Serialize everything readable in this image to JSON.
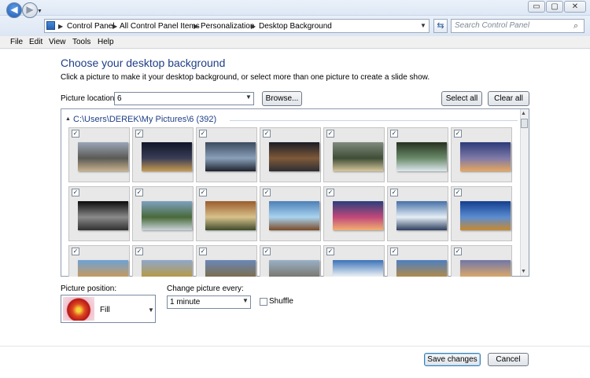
{
  "window": {
    "minimize": "▭",
    "maximize": "▢",
    "close": "✕"
  },
  "nav": {
    "breadcrumbs": [
      "Control Panel",
      "All Control Panel Items",
      "Personalization",
      "Desktop Background"
    ],
    "search_placeholder": "Search Control Panel"
  },
  "menu": [
    "File",
    "Edit",
    "View",
    "Tools",
    "Help"
  ],
  "main": {
    "heading": "Choose your desktop background",
    "subtitle": "Click a picture to make it your desktop background, or select more than one picture to create a slide show.",
    "location_label": "Picture location:",
    "location_value": "6",
    "browse_label": "Browse...",
    "select_all_label": "Select all",
    "clear_all_label": "Clear all",
    "group_header": "C:\\Users\\DEREK\\My Pictures\\6 (392)",
    "thumbnails": [
      {
        "checked": true,
        "colors": [
          "#9aa6b6",
          "#5b5a55",
          "#c8b28e"
        ]
      },
      {
        "checked": true,
        "colors": [
          "#101528",
          "#3a3d56",
          "#c89b50"
        ]
      },
      {
        "checked": true,
        "colors": [
          "#3c4a5e",
          "#8aa0b9",
          "#1d232d"
        ]
      },
      {
        "checked": true,
        "colors": [
          "#1b1d26",
          "#7e5a3a",
          "#2e2d33"
        ]
      },
      {
        "checked": true,
        "colors": [
          "#7f8b7c",
          "#3f4d37",
          "#d7c89b"
        ]
      },
      {
        "checked": true,
        "colors": [
          "#27321f",
          "#6a8a6a",
          "#dfe8ef"
        ]
      },
      {
        "checked": true,
        "colors": [
          "#2b3a78",
          "#7f7aa8",
          "#e7a75d"
        ]
      },
      {
        "checked": true,
        "colors": [
          "#0b0b0b",
          "#8a8a8a",
          "#303030"
        ]
      },
      {
        "checked": true,
        "colors": [
          "#7ea0c0",
          "#496a3a",
          "#c9d3da"
        ]
      },
      {
        "checked": true,
        "colors": [
          "#9b5b2c",
          "#d7c18b",
          "#3e4a2c"
        ]
      },
      {
        "checked": true,
        "colors": [
          "#4d7fb7",
          "#a8d3ef",
          "#7b4a27"
        ]
      },
      {
        "checked": true,
        "colors": [
          "#2a3e7c",
          "#c1487a",
          "#f2b170"
        ]
      },
      {
        "checked": true,
        "colors": [
          "#4570a6",
          "#e5eef6",
          "#2d3f5e"
        ]
      },
      {
        "checked": true,
        "colors": [
          "#133f8f",
          "#5b8cd1",
          "#c88a2e"
        ]
      },
      {
        "checked": true,
        "colors": [
          "#6da2d6",
          "#c39a62",
          "#e6eef5"
        ]
      },
      {
        "checked": true,
        "colors": [
          "#8ea7cc",
          "#b69a4a",
          "#d8e3ee"
        ]
      },
      {
        "checked": true,
        "colors": [
          "#6a88b8",
          "#7b6e52",
          "#e8eef4"
        ]
      },
      {
        "checked": true,
        "colors": [
          "#9ab0c7",
          "#7b7a72",
          "#4a4a46"
        ]
      },
      {
        "checked": true,
        "colors": [
          "#3a73b8",
          "#e9eef4",
          "#5b5a60"
        ]
      },
      {
        "checked": true,
        "colors": [
          "#4c7fc2",
          "#ad8a4f",
          "#e4e9ef"
        ]
      },
      {
        "checked": true,
        "colors": [
          "#7077a8",
          "#d6a66c",
          "#2a2f4a"
        ]
      }
    ]
  },
  "bottom": {
    "position_label": "Picture position:",
    "position_value": "Fill",
    "change_label": "Change picture every:",
    "change_value": "1 minute",
    "shuffle_label": "Shuffle",
    "save_label": "Save changes",
    "cancel_label": "Cancel"
  }
}
